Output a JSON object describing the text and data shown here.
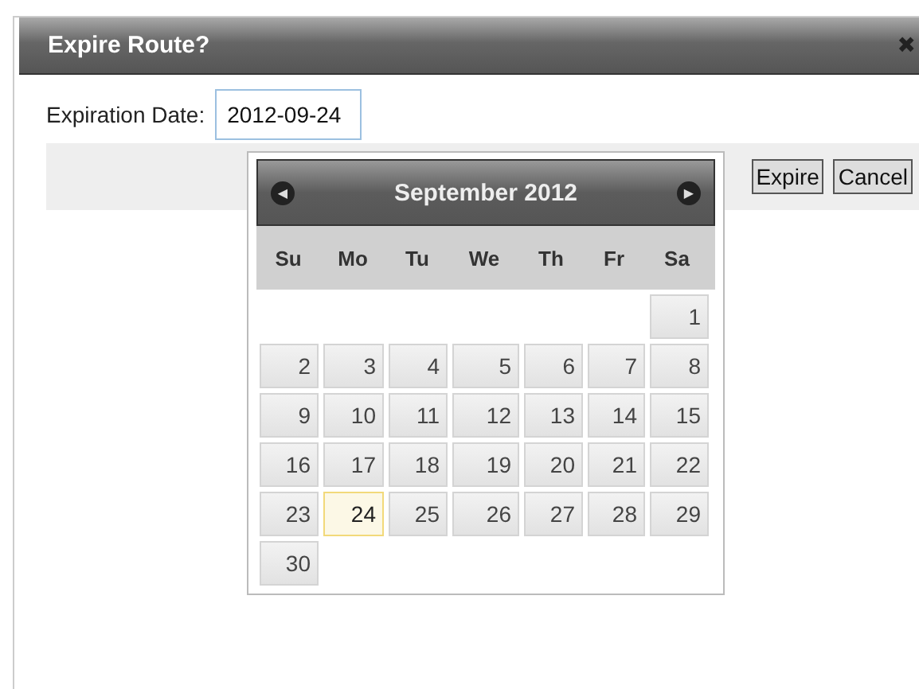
{
  "dialog": {
    "title": "Expire Route?",
    "close": "✖"
  },
  "form": {
    "label": "Expiration Date:",
    "value": "2012-09-24"
  },
  "buttons": [
    "Expire",
    "Cancel"
  ],
  "datepicker": {
    "prev": "◀",
    "next": "▶",
    "month": "September 2012",
    "weekdays": [
      "Su",
      "Mo",
      "Tu",
      "We",
      "Th",
      "Fr",
      "Sa"
    ],
    "weeks": [
      [
        {
          "day": "1",
          "selected": false
        }
      ],
      [
        {
          "day": "2",
          "selected": false
        },
        {
          "day": "3",
          "selected": false
        },
        {
          "day": "4",
          "selected": false
        },
        {
          "day": "5",
          "selected": false
        },
        {
          "day": "6",
          "selected": false
        },
        {
          "day": "7",
          "selected": false
        },
        {
          "day": "8",
          "selected": false
        }
      ],
      [
        {
          "day": "9",
          "selected": false
        },
        {
          "day": "10",
          "selected": false
        },
        {
          "day": "11",
          "selected": false
        },
        {
          "day": "12",
          "selected": false
        },
        {
          "day": "13",
          "selected": false
        },
        {
          "day": "14",
          "selected": false
        },
        {
          "day": "15",
          "selected": false
        }
      ],
      [
        {
          "day": "16",
          "selected": false
        },
        {
          "day": "17",
          "selected": false
        },
        {
          "day": "18",
          "selected": false
        },
        {
          "day": "19",
          "selected": false
        },
        {
          "day": "20",
          "selected": false
        },
        {
          "day": "21",
          "selected": false
        },
        {
          "day": "22",
          "selected": false
        }
      ],
      [
        {
          "day": "23",
          "selected": false
        },
        {
          "day": "24",
          "selected": true
        },
        {
          "day": "25",
          "selected": false
        },
        {
          "day": "26",
          "selected": false
        },
        {
          "day": "27",
          "selected": false
        },
        {
          "day": "28",
          "selected": false
        },
        {
          "day": "29",
          "selected": false
        }
      ],
      [
        {
          "day": "30",
          "selected": false
        }
      ]
    ]
  }
}
